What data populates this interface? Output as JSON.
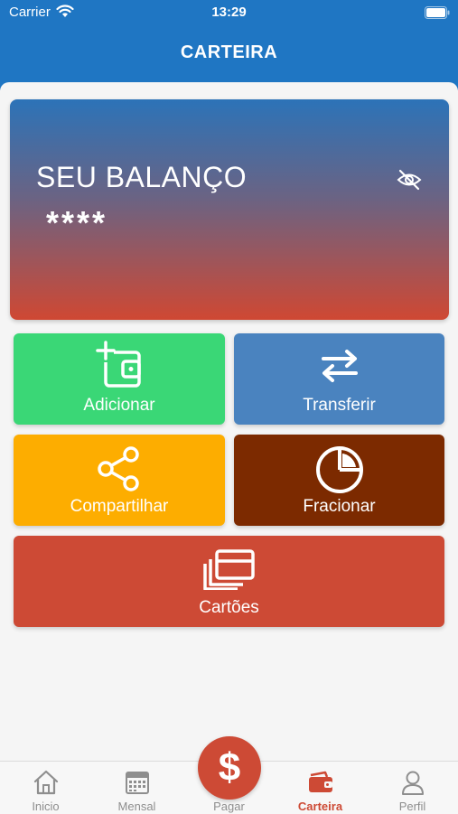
{
  "status": {
    "carrier": "Carrier",
    "time": "13:29"
  },
  "header": {
    "title": "CARTEIRA"
  },
  "balance": {
    "label": "SEU BALANÇO",
    "value": "****",
    "visibility_icon": "eye-off-icon"
  },
  "actions": {
    "add": {
      "label": "Adicionar",
      "icon": "wallet-add-icon",
      "color": "#3ad776"
    },
    "transfer": {
      "label": "Transferir",
      "icon": "swap-arrows-icon",
      "color": "#4a83bf"
    },
    "share": {
      "label": "Compartilhar",
      "icon": "share-icon",
      "color": "#fdad00"
    },
    "split": {
      "label": "Fracionar",
      "icon": "pie-chart-icon",
      "color": "#7c2a00"
    },
    "cards": {
      "label": "Cartões",
      "icon": "cards-icon",
      "color": "#cd4a35"
    }
  },
  "pay": {
    "symbol": "$"
  },
  "tabs": [
    {
      "label": "Inicio",
      "icon": "home-icon"
    },
    {
      "label": "Mensal",
      "icon": "calendar-icon"
    },
    {
      "label": "Pagar",
      "icon": "dollar-icon"
    },
    {
      "label": "Carteira",
      "icon": "wallet-icon",
      "active": true
    },
    {
      "label": "Perfil",
      "icon": "user-icon"
    }
  ],
  "colors": {
    "header": "#1f76c3",
    "accent": "#cd4a35",
    "inactive": "#8e8e8e"
  }
}
